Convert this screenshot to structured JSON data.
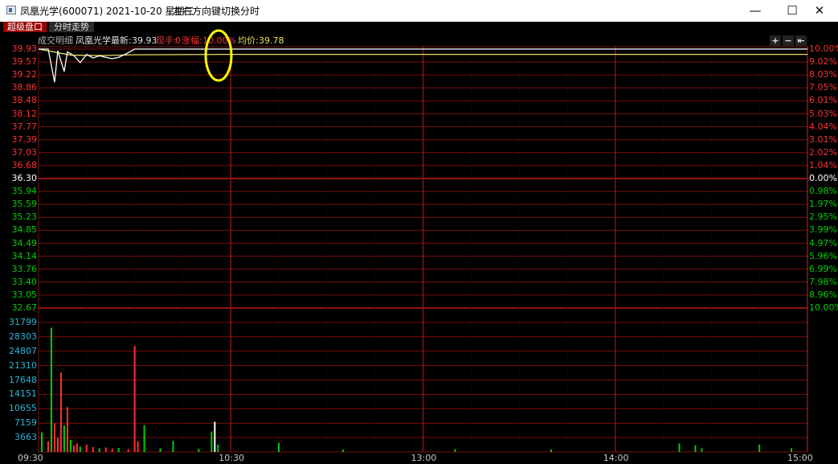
{
  "window": {
    "title": "凤凰光学(600071) 2021-10-20 星期三",
    "hint": "左右方向键切换分时",
    "minimize_glyph": "—",
    "maximize_glyph": "☐",
    "close_glyph": "✕"
  },
  "tabs": [
    {
      "label": "超级盘口",
      "active": true
    },
    {
      "label": "分时走势",
      "active": false
    }
  ],
  "infobar": {
    "detail_label": "成交明细",
    "stock_name": "凤凰光学",
    "latest_label": "最新:",
    "latest_value": "39.93",
    "now_hand_label": "现手:",
    "now_hand_value": "0",
    "change_label": "涨幅:",
    "change_value": "10.00%",
    "avg_label": "均价:",
    "avg_value": "39.78"
  },
  "zoom": {
    "plus": "+",
    "minus": "−",
    "back": "⇤"
  },
  "colors": {
    "background": "#000000",
    "grid": "#7a0f0f",
    "up": "#ff3030",
    "down": "#00d000",
    "neutral": "#ffffff",
    "avg_line": "#e8e060",
    "volume_label": "#29b6d8",
    "annotation": "#ffff00"
  },
  "chart_data": {
    "type": "line",
    "title": "",
    "prev_close": 36.3,
    "price_axis": [
      "39.93",
      "39.57",
      "39.22",
      "38.86",
      "38.48",
      "38.12",
      "37.77",
      "37.39",
      "37.03",
      "36.68",
      "36.30",
      "35.94",
      "35.59",
      "35.23",
      "34.85",
      "34.49",
      "34.14",
      "33.76",
      "33.40",
      "33.05",
      "32.67"
    ],
    "pct_axis": [
      "10.00%",
      "9.02%",
      "8.03%",
      "7.05%",
      "6.01%",
      "5.03%",
      "4.04%",
      "3.01%",
      "2.02%",
      "1.04%",
      "0.00%",
      "0.98%",
      "1.97%",
      "2.95%",
      "3.99%",
      "4.97%",
      "5.96%",
      "6.99%",
      "7.98%",
      "8.96%",
      "10.00%"
    ],
    "volume_axis": [
      "31799",
      "28303",
      "24807",
      "21310",
      "17648",
      "14151",
      "10655",
      "7159",
      "3663"
    ],
    "time_axis": [
      "09:30",
      "10:30",
      "13:00",
      "14:00",
      "15:00"
    ],
    "price_series": {
      "name": "",
      "x": [
        "09:30",
        "09:33",
        "09:35",
        "09:36",
        "09:38",
        "09:39",
        "09:41",
        "09:43",
        "09:45",
        "09:47",
        "09:49",
        "09:51",
        "09:53",
        "09:55",
        "09:57",
        "10:00",
        "10:05",
        "10:06",
        "15:00"
      ],
      "values": [
        39.93,
        39.93,
        39.0,
        39.88,
        39.3,
        39.85,
        39.75,
        39.55,
        39.78,
        39.68,
        39.74,
        39.7,
        39.66,
        39.7,
        39.78,
        39.93,
        39.93,
        39.93,
        39.93
      ]
    },
    "avg_series": {
      "name": "",
      "x": [
        "09:30",
        "09:40",
        "09:50",
        "10:00",
        "10:30",
        "13:00",
        "14:00",
        "15:00"
      ],
      "values": [
        39.93,
        39.76,
        39.75,
        39.77,
        39.78,
        39.78,
        39.78,
        39.78
      ]
    },
    "volume_bars": [
      {
        "t": "09:31",
        "v": 4800,
        "c": "down"
      },
      {
        "t": "09:33",
        "v": 2600,
        "c": "up"
      },
      {
        "t": "09:34",
        "v": 30500,
        "c": "down"
      },
      {
        "t": "09:35",
        "v": 7000,
        "c": "up"
      },
      {
        "t": "09:36",
        "v": 3500,
        "c": "up"
      },
      {
        "t": "09:37",
        "v": 19500,
        "c": "up"
      },
      {
        "t": "09:38",
        "v": 6500,
        "c": "down"
      },
      {
        "t": "09:39",
        "v": 11000,
        "c": "up"
      },
      {
        "t": "09:40",
        "v": 3000,
        "c": "down"
      },
      {
        "t": "09:41",
        "v": 1600,
        "c": "up"
      },
      {
        "t": "09:42",
        "v": 2100,
        "c": "up"
      },
      {
        "t": "09:43",
        "v": 1300,
        "c": "down"
      },
      {
        "t": "09:45",
        "v": 1800,
        "c": "up"
      },
      {
        "t": "09:47",
        "v": 1200,
        "c": "up"
      },
      {
        "t": "09:49",
        "v": 900,
        "c": "down"
      },
      {
        "t": "09:51",
        "v": 1100,
        "c": "up"
      },
      {
        "t": "09:53",
        "v": 800,
        "c": "up"
      },
      {
        "t": "09:55",
        "v": 1000,
        "c": "down"
      },
      {
        "t": "09:58",
        "v": 700,
        "c": "up"
      },
      {
        "t": "10:00",
        "v": 26000,
        "c": "up"
      },
      {
        "t": "10:01",
        "v": 2600,
        "c": "up"
      },
      {
        "t": "10:03",
        "v": 6600,
        "c": "down"
      },
      {
        "t": "10:08",
        "v": 900,
        "c": "down"
      },
      {
        "t": "10:12",
        "v": 2700,
        "c": "down"
      },
      {
        "t": "10:20",
        "v": 800,
        "c": "down"
      },
      {
        "t": "10:24",
        "v": 5000,
        "c": "down"
      },
      {
        "t": "10:25",
        "v": 7400,
        "c": "neutral"
      },
      {
        "t": "10:26",
        "v": 1800,
        "c": "down"
      },
      {
        "t": "10:45",
        "v": 2200,
        "c": "down"
      },
      {
        "t": "11:05",
        "v": 600,
        "c": "down"
      },
      {
        "t": "13:10",
        "v": 700,
        "c": "down"
      },
      {
        "t": "13:40",
        "v": 600,
        "c": "down"
      },
      {
        "t": "14:20",
        "v": 2100,
        "c": "down"
      },
      {
        "t": "14:25",
        "v": 1600,
        "c": "down"
      },
      {
        "t": "14:27",
        "v": 900,
        "c": "down"
      },
      {
        "t": "14:45",
        "v": 1800,
        "c": "down"
      },
      {
        "t": "14:55",
        "v": 900,
        "c": "down"
      }
    ]
  }
}
